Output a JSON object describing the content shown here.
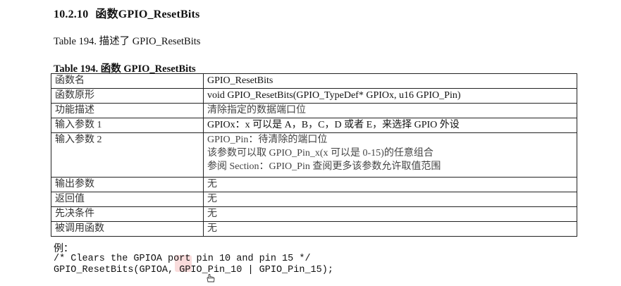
{
  "section": {
    "number": "10.2.10",
    "title": "函数GPIO_ResetBits"
  },
  "description": "Table 194. 描述了 GPIO_ResetBits",
  "table": {
    "caption": "Table 194. 函数 GPIO_ResetBits",
    "rows": [
      {
        "key": "函数名",
        "value": [
          "GPIO_ResetBits"
        ]
      },
      {
        "key": "函数原形",
        "value": [
          "void GPIO_ResetBits(GPIO_TypeDef* GPIOx, u16 GPIO_Pin)"
        ]
      },
      {
        "key": "功能描述",
        "value": [
          "清除指定的数据端口位"
        ]
      },
      {
        "key": "输入参数 1",
        "value": [
          "GPIOx：x 可以是 A，B，C，D 或者 E，来选择 GPIO 外设"
        ]
      },
      {
        "key": "输入参数 2",
        "value": [
          "GPIO_Pin：待清除的端口位",
          "该参数可以取 GPIO_Pin_x(x 可以是 0-15)的任意组合",
          "参阅 Section：GPIO_Pin 查阅更多该参数允许取值范围"
        ]
      },
      {
        "key": "输出参数",
        "value": [
          "无"
        ]
      },
      {
        "key": "返回值",
        "value": [
          "无"
        ]
      },
      {
        "key": "先决条件",
        "value": [
          "无"
        ]
      },
      {
        "key": "被调用函数",
        "value": [
          "无"
        ]
      }
    ]
  },
  "example": {
    "label": "例：",
    "code_lines": [
      "/* Clears the GPIOA port pin 10 and pin 15 */",
      "GPIO_ResetBits(GPIOA, GPIO_Pin_10 | GPIO_Pin_15);"
    ]
  }
}
